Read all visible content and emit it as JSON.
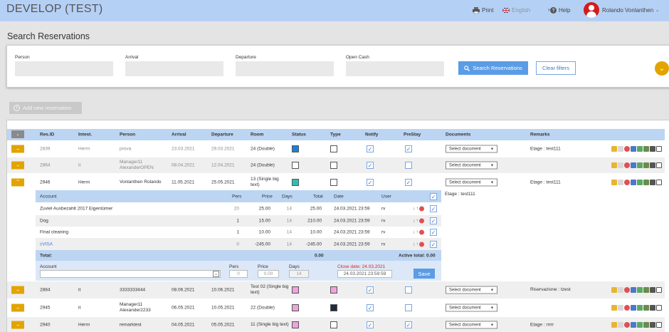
{
  "app": {
    "title": "DEVELOP (TEST)"
  },
  "topbar": {
    "print_label": "Print",
    "language_label": "English",
    "help_label": "Help",
    "user_name": "Rolando Vonlanthen"
  },
  "page": {
    "title": "Search Reservations"
  },
  "filters": {
    "person_label": "Person",
    "arrival_label": "Arrival",
    "departure_label": "Departure",
    "open_cash_label": "Open Cash",
    "person_value": "",
    "arrival_value": "",
    "departure_value": "",
    "open_cash_value": "",
    "search_label": "Search Reservations",
    "clear_label": "Clear filters"
  },
  "add_reservation_label": "Add new reservation",
  "table": {
    "headers": {
      "res_id": "Res.ID",
      "intest": "Intest.",
      "person": "Person",
      "arrival": "Arrival",
      "departure": "Departure",
      "room": "Room",
      "status": "Status",
      "type": "Type",
      "notify": "Notify",
      "prestay": "PreStay",
      "documents": "Documents",
      "remarks": "Remarks"
    },
    "select_document_label": "Select document",
    "rows": [
      {
        "res_id": "2839",
        "intest": "Herrn",
        "person": "prova",
        "arrival": "23.03.2021",
        "departure": "29.03.2021",
        "room": "24 (Double)",
        "status_color": "#1f7fd6",
        "type_color": "#ffffff",
        "notify": true,
        "prestay": true,
        "remarks": "Etage : test111",
        "muted": true
      },
      {
        "res_id": "2864",
        "intest": "it",
        "person": "Manager11 AlexanderOPEN",
        "arrival": "08.04.2021",
        "departure": "12.04.2021",
        "room": "24 (Double)",
        "status_color": "#ffffff",
        "type_color": "#ffffff",
        "notify": true,
        "prestay": false,
        "remarks": "",
        "muted": true
      },
      {
        "res_id": "2946",
        "intest": "Herrn",
        "person": "Vonlanthen Rolando",
        "arrival": "11.05.2021",
        "departure": "25.05.2021",
        "room": "13 (Single big text)",
        "status_color": "#2cc0b2",
        "type_color": "#ffffff",
        "notify": true,
        "prestay": true,
        "remarks": "Etage : test111",
        "muted": false
      },
      {
        "res_id": "2884",
        "intest": "it",
        "person": "3333333444",
        "arrival": "08.06.2021",
        "departure": "10.06.2021",
        "room": "Test 02 (Single big text)",
        "status_color": "#f0a3dc",
        "type_color": "#f0a3dc",
        "notify": true,
        "prestay": false,
        "remarks": "Riservazione : tzest",
        "muted": false
      },
      {
        "res_id": "2945",
        "intest": "it",
        "person": "Manager11 Alexander2233",
        "arrival": "06.05.2021",
        "departure": "10.05.2021",
        "room": "22 (Double)",
        "status_color": "#f0a3dc",
        "type_color": "#1f2a44",
        "notify": true,
        "prestay": false,
        "remarks": "",
        "muted": false
      },
      {
        "res_id": "2940",
        "intest": "Herrn",
        "person": "remarktest",
        "arrival": "04.05.2021",
        "departure": "05.05.2021",
        "room": "11 (Single big text)",
        "status_color": "#f0a3dc",
        "type_color": "#ffffff",
        "notify": true,
        "prestay": true,
        "remarks": "Etage : rrrrr",
        "muted": false
      }
    ]
  },
  "expanded": {
    "remarks": "Etage : test111",
    "headers": {
      "account": "Account",
      "pers": "Pers",
      "price": "Price",
      "days": "Days",
      "total": "Total",
      "date": "Date",
      "user": "User"
    },
    "items": [
      {
        "account": "Zuviel Ausbezahlt 2017 Eigentümer",
        "pers": "20",
        "price": "25.00",
        "days": "14",
        "total": "25.00",
        "date": "24.03.2021 23:59",
        "user": "rv",
        "checked": true
      },
      {
        "account": "Dog",
        "pers": "1",
        "price": "15.00",
        "days": "14",
        "total": "210.00",
        "date": "24.03.2021 23:59",
        "user": "rv",
        "checked": true
      },
      {
        "account": "Final cleaning",
        "pers": "1",
        "price": "10.00",
        "days": "14",
        "total": "10.00",
        "date": "24.03.2021 23:59",
        "user": "rv",
        "checked": true
      },
      {
        "account": "cVISA",
        "pers": "0",
        "price": "-245.00",
        "days": "14",
        "total": "-245.00",
        "date": "24.03.2021 23:59",
        "user": "rv",
        "checked": true
      }
    ],
    "total_label": "Total:",
    "total_value": "0.00",
    "active_total": "Active total: 0.00",
    "form": {
      "account_label": "Account",
      "pers_label": "Pers",
      "price_label": "Price",
      "days_label": "Days",
      "pers_value": "0",
      "price_value": "0.00",
      "days_value": "14",
      "close_date_label": "Close date: 24.03.2021",
      "close_date_value": "24.03.2021 23:59:59",
      "save_label": "Save"
    }
  }
}
